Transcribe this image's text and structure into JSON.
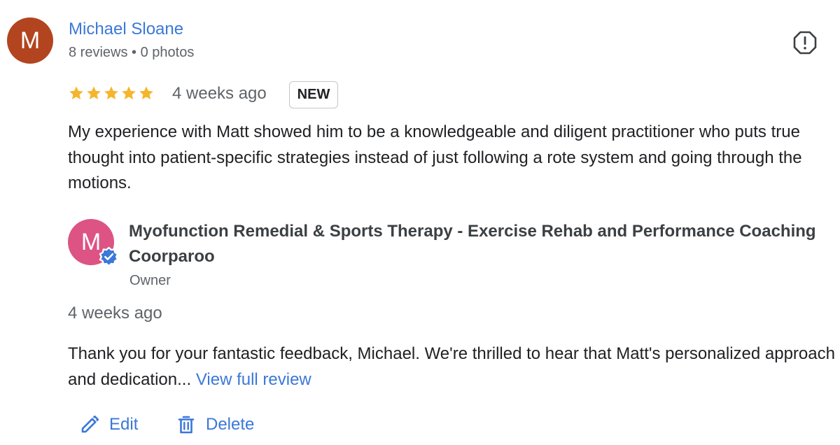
{
  "reviewer": {
    "initial": "M",
    "avatar_color": "#b2451f",
    "name": "Michael Sloane",
    "meta": "8 reviews • 0 photos"
  },
  "review": {
    "rating": 5,
    "star_color": "#f5b52c",
    "time": "4 weeks ago",
    "badge": "NEW",
    "text": "My experience with Matt showed him to be a knowledgeable and diligent practitioner who puts true thought into patient-specific strategies instead of just following a rote system and going through the motions."
  },
  "owner_reply": {
    "initial": "M",
    "avatar_color": "#dd5384",
    "verified_color": "#3b78d8",
    "business_name": "Myofunction Remedial & Sports Therapy - Exercise Rehab and Performance Coaching Coorparoo",
    "role": "Owner",
    "time": "4 weeks ago",
    "text": "Thank you for your fantastic feedback, Michael. We're thrilled to hear that Matt's personalized approach and dedication... ",
    "more_link": "View full review"
  },
  "actions": {
    "edit_label": "Edit",
    "delete_label": "Delete"
  },
  "icons": {
    "flag": "report-icon",
    "edit": "pencil-icon",
    "delete": "trash-icon"
  }
}
